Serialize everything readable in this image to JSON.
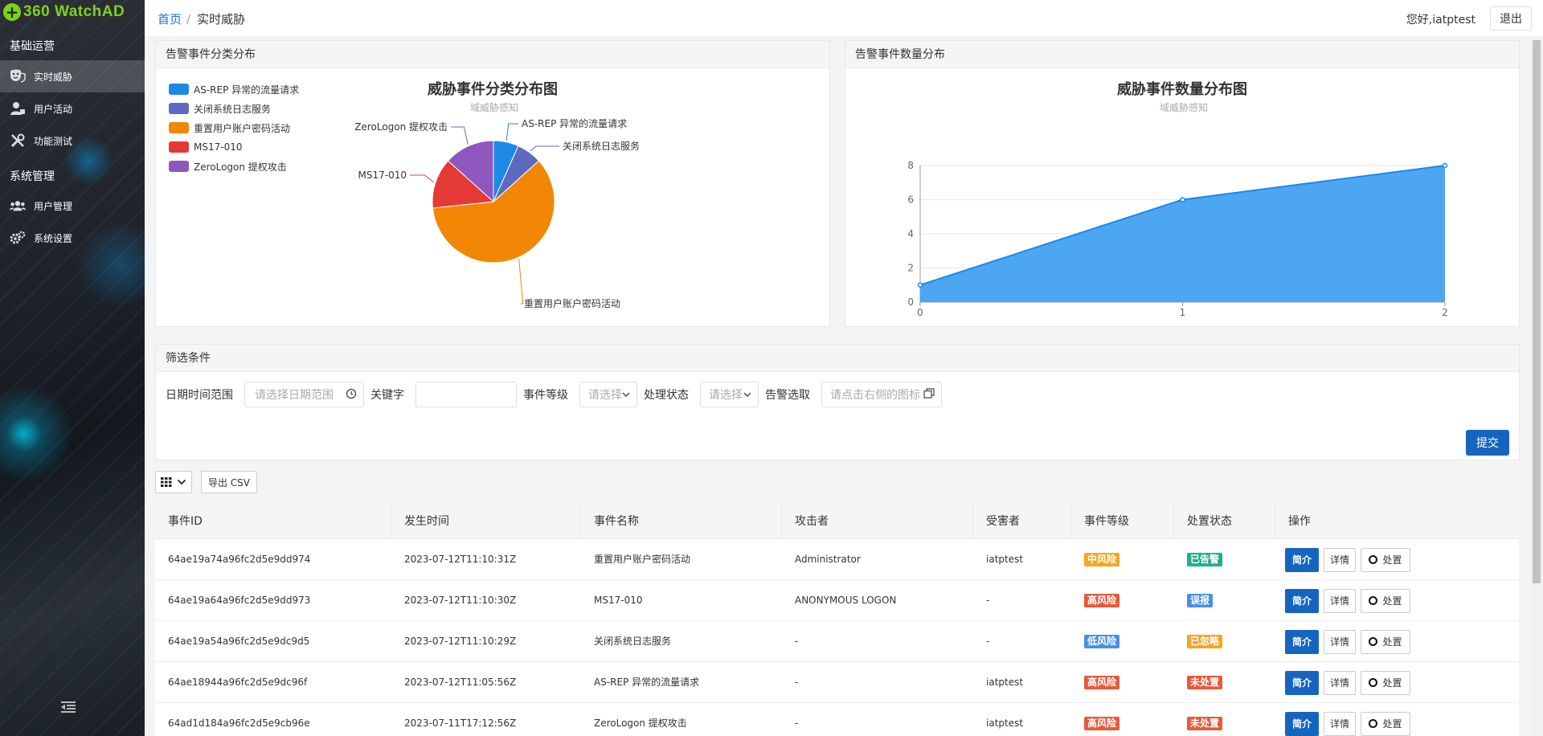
{
  "app": {
    "logo_text": "360 WatchAD"
  },
  "sidebar": {
    "group_ops": "基础运营",
    "group_sys": "系统管理",
    "items": [
      {
        "label": "实时威胁",
        "icon": "mask-icon"
      },
      {
        "label": "用户活动",
        "icon": "user-activity-icon"
      },
      {
        "label": "功能测试",
        "icon": "tools-icon"
      },
      {
        "label": "用户管理",
        "icon": "users-icon"
      },
      {
        "label": "系统设置",
        "icon": "gears-icon"
      }
    ]
  },
  "header": {
    "crumb_home": "首页",
    "crumb_sep": "/",
    "crumb_current": "实时威胁",
    "greeting": "您好,iatptest",
    "logout": "退出"
  },
  "pie_panel": {
    "title": "告警事件分类分布",
    "legend": [
      {
        "name": "AS-REP 异常的流量请求",
        "color": "#1e88e5"
      },
      {
        "name": "关闭系统日志服务",
        "color": "#5c6bc0"
      },
      {
        "name": "重置用户账户密码活动",
        "color": "#f28705"
      },
      {
        "name": "MS17-010",
        "color": "#e53935"
      },
      {
        "name": "ZeroLogon 提权攻击",
        "color": "#8e57c0"
      }
    ]
  },
  "line_panel": {
    "title": "告警事件数量分布"
  },
  "chart_data": [
    {
      "type": "pie",
      "title": "威胁事件分类分布图",
      "subtitle": "域威胁感知",
      "slices": [
        {
          "label": "AS-REP 异常的流量请求",
          "value": 1,
          "color": "#1e88e5"
        },
        {
          "label": "关闭系统日志服务",
          "value": 1,
          "color": "#5c6bc0"
        },
        {
          "label": "重置用户账户密码活动",
          "value": 9,
          "color": "#f28705"
        },
        {
          "label": "MS17-010",
          "value": 2,
          "color": "#e53935"
        },
        {
          "label": "ZeroLogon 提权攻击",
          "value": 2,
          "color": "#8e57c0"
        }
      ]
    },
    {
      "type": "area",
      "title": "威胁事件数量分布图",
      "subtitle": "域威胁感知",
      "x": [
        0,
        1,
        2
      ],
      "y": [
        1,
        6,
        8
      ],
      "ylim": [
        0,
        8
      ],
      "yticks": [
        0,
        2,
        4,
        6,
        8
      ],
      "color": "#4ca6f1",
      "line_color": "#1e88e5",
      "grid": true
    }
  ],
  "filter": {
    "title": "筛选条件",
    "date_label": "日期时间范围",
    "date_placeholder": "请选择日期范围",
    "keyword_label": "关键字",
    "level_label": "事件等级",
    "level_placeholder": "请选择",
    "status_label": "处理状态",
    "status_placeholder": "请选择",
    "alert_label": "告警选取",
    "alert_placeholder": "请点击右侧的图标",
    "submit": "提交"
  },
  "toolbar": {
    "export_csv": "导出 CSV"
  },
  "table": {
    "headers": [
      "事件ID",
      "发生时间",
      "事件名称",
      "攻击者",
      "受害者",
      "事件等级",
      "处置状态",
      "操作"
    ],
    "actions": {
      "brief": "简介",
      "detail": "详情",
      "handle": "处置"
    },
    "rows": [
      {
        "id": "64ae19a74a96fc2d5e9dd974",
        "time": "2023-07-12T11:10:31Z",
        "name": "重置用户账户密码活动",
        "attacker": "Administrator",
        "victim": "iatptest",
        "level": "中风险",
        "level_color": "#f5a623",
        "status": "已告警",
        "status_color": "#1fb08a"
      },
      {
        "id": "64ae19a64a96fc2d5e9dd973",
        "time": "2023-07-12T11:10:30Z",
        "name": "MS17-010",
        "attacker": "ANONYMOUS LOGON",
        "victim": "-",
        "level": "高风险",
        "level_color": "#e65a3c",
        "status": "误报",
        "status_color": "#4a90e2"
      },
      {
        "id": "64ae19a54a96fc2d5e9dc9d5",
        "time": "2023-07-12T11:10:29Z",
        "name": "关闭系统日志服务",
        "attacker": "-",
        "victim": "-",
        "level": "低风险",
        "level_color": "#4a90e2",
        "status": "已忽略",
        "status_color": "#f5a623"
      },
      {
        "id": "64ae18944a96fc2d5e9dc96f",
        "time": "2023-07-12T11:05:56Z",
        "name": "AS-REP 异常的流量请求",
        "attacker": "-",
        "victim": "iatptest",
        "level": "高风险",
        "level_color": "#e65a3c",
        "status": "未处置",
        "status_color": "#e65a3c"
      },
      {
        "id": "64ad1d184a96fc2d5e9cb96e",
        "time": "2023-07-11T17:12:56Z",
        "name": "ZeroLogon 提权攻击",
        "attacker": "-",
        "victim": "iatptest",
        "level": "高风险",
        "level_color": "#e65a3c",
        "status": "未处置",
        "status_color": "#e65a3c"
      }
    ]
  }
}
